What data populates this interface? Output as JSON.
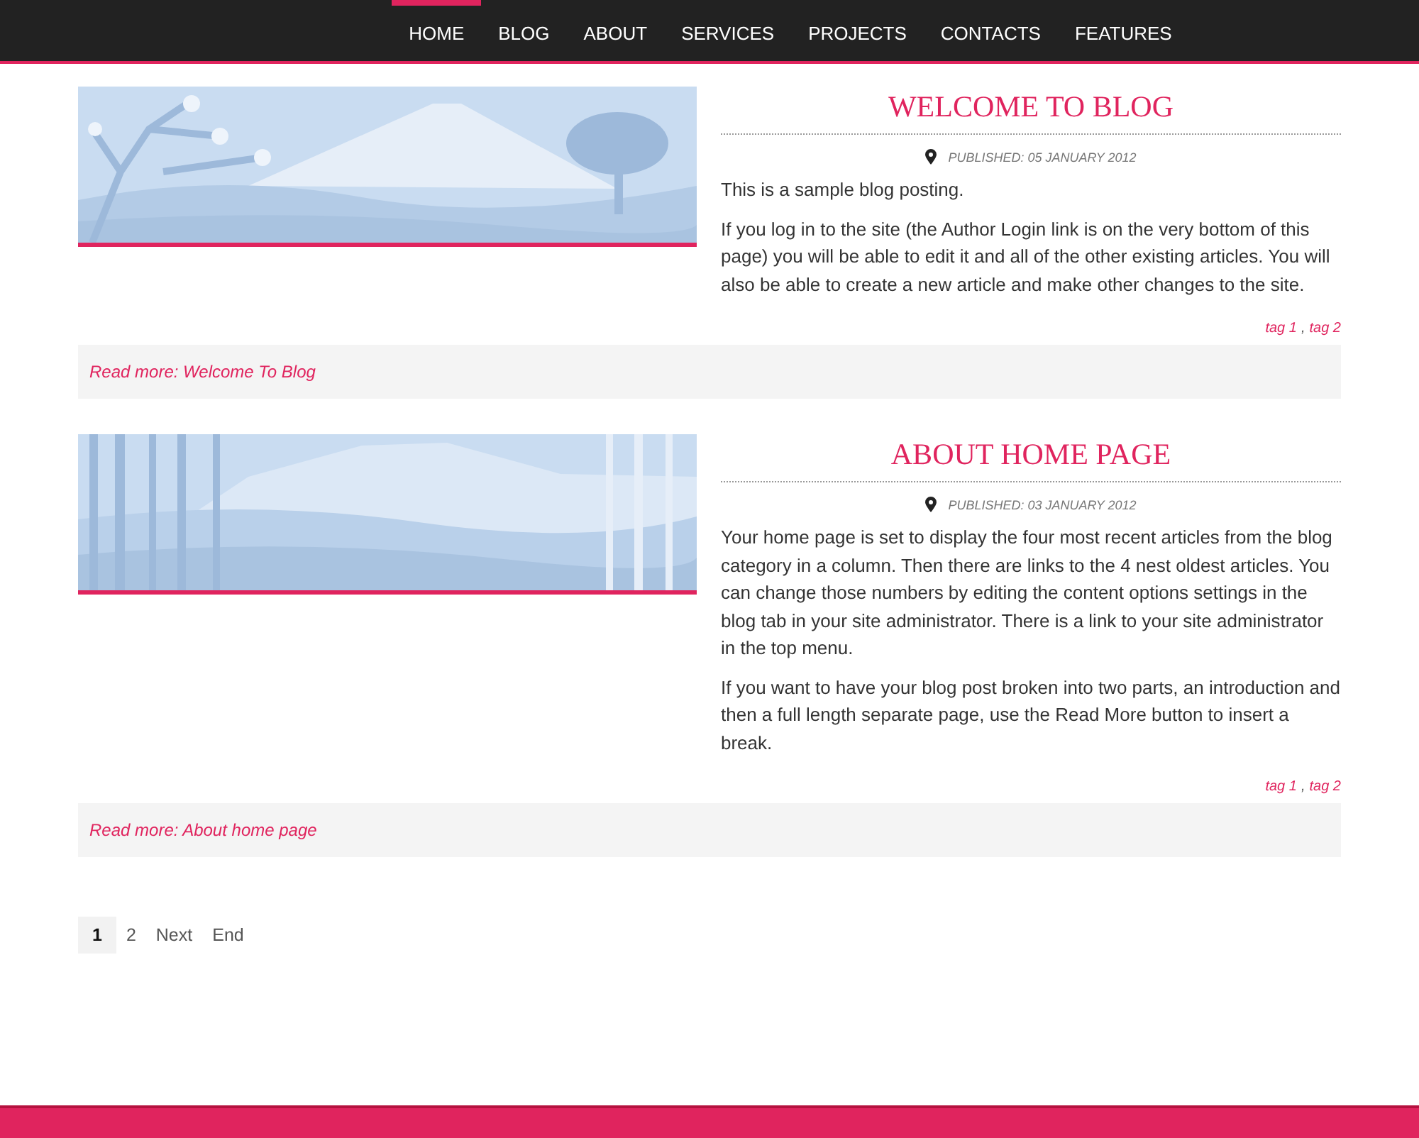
{
  "nav": [
    {
      "label": "HOME",
      "selected": true
    },
    {
      "label": "BLOG",
      "selected": false
    },
    {
      "label": "ABOUT",
      "selected": false
    },
    {
      "label": "SERVICES",
      "selected": false
    },
    {
      "label": "PROJECTS",
      "selected": false
    },
    {
      "label": "CONTACTS",
      "selected": false
    },
    {
      "label": "FEATURES",
      "selected": false
    }
  ],
  "articles": [
    {
      "image": {
        "kind": "blossom"
      },
      "title": "WELCOME TO BLOG",
      "published": "PUBLISHED: 05 JANUARY 2012",
      "paragraphs": [
        "This is a sample blog posting.",
        "If you log in to the site (the Author Login link is on the very bottom of this page) you will be able to edit it and all of the other existing articles. You will also be able to create a new article and make other changes to the site."
      ],
      "tags": [
        "tag 1",
        "tag 2"
      ],
      "tag_separator": ",",
      "read_more": "Read more: Welcome To Blog"
    },
    {
      "image": {
        "kind": "bamboo"
      },
      "title": "ABOUT HOME PAGE",
      "published": "PUBLISHED: 03 JANUARY 2012",
      "paragraphs": [
        "Your home page is set to display the four most recent articles from the blog category in a column. Then there are links to the 4 nest oldest articles. You can change those numbers by editing the content options settings in the blog tab in your site administrator. There is a link to your site administrator in the top menu.",
        "If you want to have your blog post broken into two parts, an introduction and then a full length separate page, use the Read More button to insert a break."
      ],
      "tags": [
        "tag 1",
        "tag 2"
      ],
      "tag_separator": ",",
      "read_more": "Read more: About home page"
    }
  ],
  "pagination": [
    {
      "label": "1",
      "selected": true
    },
    {
      "label": "2",
      "selected": false
    },
    {
      "label": "Next",
      "selected": false
    },
    {
      "label": "End",
      "selected": false
    }
  ]
}
